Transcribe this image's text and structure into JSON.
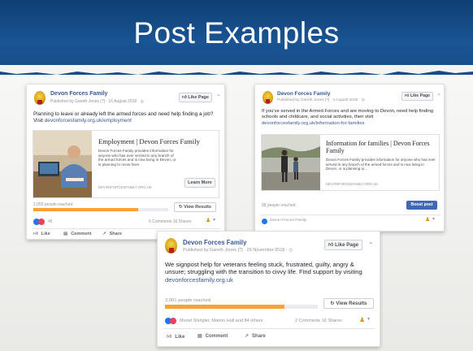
{
  "slide": {
    "title": "Post Examples"
  },
  "colors": {
    "banner": "#164a84",
    "facebook_blue": "#385898",
    "reach_orange": "#f7a234",
    "boost_blue": "#4267b2"
  },
  "posts": [
    {
      "page_name": "Devon Forces Family",
      "byline": "Published by Gareth Jones [?] · 16 August 2018 · ",
      "like_button": "Like Page",
      "text": "Planning to leave or already left the armed forces and need help finding a job? Visit ",
      "link_url": "devonforcesfamily.org.uk/employment",
      "link_card": {
        "title": "Employment | Devon Forces Family",
        "description": "Devon Forces Family provides information for anyone who has ever served in any branch of the armed forces and is now living in Devon, or is planning to move here.",
        "domain": "DEVONFORCESFAMILY.ORG.UK",
        "cta": "Learn More"
      },
      "reach": {
        "label": "2,055 people reached",
        "fraction": 0.78
      },
      "results_button": "View Results",
      "reaction_count": "45",
      "stats": "5 Comments  16 Shares",
      "actions": [
        "Like",
        "Comment",
        "Share"
      ]
    },
    {
      "page_name": "Devon Forces Family",
      "byline": "Published by Gareth Jones [?] · 4 August 2018 · ",
      "like_button": "Like Page",
      "text": "If you've served in the Armed Forces and are moving to Devon, need help finding schools and childcare, and social activities, then visit ",
      "link_url": "devonforcesfamily.org.uk/information-for-families",
      "link_card": {
        "title": "Information for families | Devon Forces Family",
        "description": "Devon Forces Family provides information for anyone who has ever served in any branch of the armed forces and is now living in Devon, or is planning to...",
        "domain": "DEVONFORCESFAMILY.ORG.UK"
      },
      "reach": {
        "label": "98 people reached"
      },
      "boost_button": "Boost post",
      "footer_page": "Devon Forces Family"
    },
    {
      "page_name": "Devon Forces Family",
      "byline": "Published by Gareth Jones [?] · 29 November 2018 · ",
      "like_button": "Like Page",
      "text": "We signpost help for veterans feeling stuck, frustrated, guilty, angry & unsure; struggling with the transition to civvy life. Find support by visiting ",
      "link_url": "devonforcesfamily.org.uk",
      "reach": {
        "label": "3,001 people reached",
        "fraction": 0.78
      },
      "results_button": "View Results",
      "reactors": "Muriel Shingler, Marion Hull and 84 others",
      "stats": "2 Comments  16 Shares",
      "actions": [
        "Like",
        "Comment",
        "Share"
      ]
    }
  ]
}
